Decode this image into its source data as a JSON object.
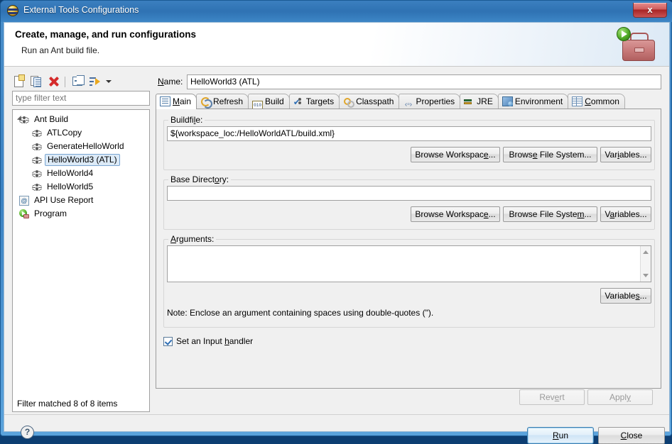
{
  "window": {
    "title": "External Tools Configurations",
    "icon": "eclipse-globe-icon",
    "close_label": "x"
  },
  "banner": {
    "title": "Create, manage, and run configurations",
    "subtitle": "Run an Ant build file.",
    "icon": "toolbox-with-run-arrow-icon"
  },
  "tree_toolbar": {
    "buttons": [
      {
        "name": "new-launch-configuration",
        "icon": "new-config-icon"
      },
      {
        "name": "duplicate-launch-configuration",
        "icon": "duplicate-icon"
      },
      {
        "name": "delete-launch-configuration",
        "icon": "delete-red-x-icon"
      },
      {
        "name": "collapse-all",
        "icon": "collapse-all-icon"
      },
      {
        "name": "filter-launch-configurations",
        "icon": "filter-icon"
      },
      {
        "name": "filter-menu-dropdown",
        "icon": "chevron-down-icon"
      }
    ]
  },
  "filter": {
    "placeholder": "type filter text",
    "value": "",
    "status": "Filter matched 8 of 8 items"
  },
  "tree": [
    {
      "label": "Ant Build",
      "indent": 26,
      "icon": "ant-icon",
      "expanded": true,
      "selected": false
    },
    {
      "label": "ATLCopy",
      "indent": 44,
      "icon": "ant-icon",
      "selected": false
    },
    {
      "label": "GenerateHelloWorld",
      "indent": 44,
      "icon": "ant-icon",
      "selected": false
    },
    {
      "label": "HelloWorld3 (ATL)",
      "indent": 44,
      "icon": "ant-icon",
      "selected": true
    },
    {
      "label": "HelloWorld4",
      "indent": 44,
      "icon": "ant-icon",
      "selected": false
    },
    {
      "label": "HelloWorld5",
      "indent": 44,
      "icon": "ant-icon",
      "selected": false
    },
    {
      "label": "API Use Report",
      "indent": 26,
      "icon": "api-use-report-icon",
      "selected": false
    },
    {
      "label": "Program",
      "indent": 26,
      "icon": "program-run-icon",
      "selected": false
    }
  ],
  "name_field": {
    "label": "Name:",
    "mnemonic": "N",
    "value": "HelloWorld3 (ATL)"
  },
  "tabs": [
    {
      "label": "Main",
      "icon": "main-tab-icon",
      "active": true
    },
    {
      "label": "Refresh",
      "icon": "refresh-tab-icon",
      "active": false
    },
    {
      "label": "Build",
      "icon": "build-tab-icon",
      "active": false
    },
    {
      "label": "Targets",
      "icon": "targets-tab-icon",
      "active": false
    },
    {
      "label": "Classpath",
      "icon": "classpath-tab-icon",
      "active": false
    },
    {
      "label": "Properties",
      "icon": "properties-tab-icon",
      "active": false
    },
    {
      "label": "JRE",
      "icon": "jre-tab-icon",
      "active": false
    },
    {
      "label": "Environment",
      "icon": "environment-tab-icon",
      "active": false
    },
    {
      "label": "Common",
      "icon": "common-tab-icon",
      "active": false
    }
  ],
  "main_tab": {
    "buildfile": {
      "group_label_pre": "Buildfi",
      "group_label_mn": "l",
      "group_label_post": "e:",
      "value": "${workspace_loc:/HelloWorldATL/build.xml}",
      "browse_workspace_pre": "Browse Workspac",
      "browse_workspace_mn": "e",
      "browse_workspace_post": "...",
      "browse_filesystem_pre": "Brows",
      "browse_filesystem_mn": "e",
      "browse_filesystem_post": " File System...",
      "variables_pre": "Var",
      "variables_mn": "i",
      "variables_post": "ables..."
    },
    "base_directory": {
      "group_label_pre": "Base Direct",
      "group_label_mn": "o",
      "group_label_post": "ry:",
      "value": "",
      "browse_workspace_pre": "Browse Workspac",
      "browse_workspace_mn": "e",
      "browse_workspace_post": "...",
      "browse_filesystem_pre": "Browse File Syste",
      "browse_filesystem_mn": "m",
      "browse_filesystem_post": "...",
      "variables_pre": "V",
      "variables_mn": "a",
      "variables_post": "riables..."
    },
    "arguments": {
      "group_label_pre": "",
      "group_label_mn": "A",
      "group_label_post": "rguments:",
      "value": "",
      "variables_pre": "Variable",
      "variables_mn": "s",
      "variables_post": "...",
      "note": "Note: Enclose an argument containing spaces using double-quotes (\")."
    },
    "input_handler": {
      "label_pre": "Set an Input ",
      "label_mn": "h",
      "label_post": "andler",
      "checked": true
    }
  },
  "footer": {
    "revert_pre": "Rev",
    "revert_mn": "e",
    "revert_post": "rt",
    "revert_enabled": false,
    "apply_pre": "Appl",
    "apply_mn": "y",
    "apply_post": "",
    "apply_enabled": false,
    "help_icon": "?",
    "run_pre": "",
    "run_mn": "R",
    "run_post": "un",
    "close_pre": "",
    "close_mn": "C",
    "close_post": "lose"
  },
  "colors": {
    "titlebar": "#3b7fbf",
    "selection": "#dceaf7",
    "selection_border": "#7aa5d1",
    "accent": "#3c7fb1",
    "close_button": "#c85252",
    "panel_bg": "#f0f0f0"
  }
}
